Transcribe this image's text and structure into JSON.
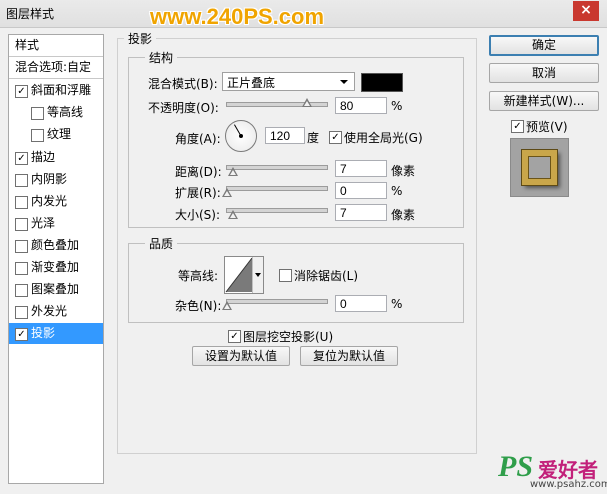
{
  "window": {
    "title": "图层样式",
    "watermark": "www.240PS.com",
    "close": "×"
  },
  "sidebar": {
    "styles_header": "样式",
    "blend_options": "混合选项:自定",
    "items": [
      {
        "label": "斜面和浮雕",
        "checked": true
      },
      {
        "label": "等高线",
        "checked": false
      },
      {
        "label": "纹理",
        "checked": false
      },
      {
        "label": "描边",
        "checked": true
      },
      {
        "label": "内阴影",
        "checked": false
      },
      {
        "label": "内发光",
        "checked": false
      },
      {
        "label": "光泽",
        "checked": false
      },
      {
        "label": "颜色叠加",
        "checked": false
      },
      {
        "label": "渐变叠加",
        "checked": false
      },
      {
        "label": "图案叠加",
        "checked": false
      },
      {
        "label": "外发光",
        "checked": false
      },
      {
        "label": "投影",
        "checked": true,
        "selected": true
      }
    ]
  },
  "panel": {
    "title": "投影",
    "structure": {
      "title": "结构",
      "blend_mode_label": "混合模式(B):",
      "blend_mode_value": "正片叠底",
      "blend_color": "#000000",
      "opacity_label": "不透明度(O):",
      "opacity_value": "80",
      "opacity_level": 80,
      "opacity_unit": "%",
      "angle_label": "角度(A):",
      "angle_value": "120",
      "angle_unit": "度",
      "global_light_label": "使用全局光(G)",
      "global_light_checked": true,
      "distance_label": "距离(D):",
      "distance_value": "7",
      "distance_unit": "像素",
      "spread_label": "扩展(R):",
      "spread_value": "0",
      "spread_unit": "%",
      "size_label": "大小(S):",
      "size_value": "7",
      "size_unit": "像素"
    },
    "quality": {
      "title": "品质",
      "contour_label": "等高线:",
      "antialias_label": "消除锯齿(L)",
      "antialias_checked": false,
      "noise_label": "杂色(N):",
      "noise_value": "0",
      "noise_unit": "%"
    },
    "knockout_label": "图层挖空投影(U)",
    "knockout_checked": true,
    "set_default": "设置为默认值",
    "reset_default": "复位为默认值"
  },
  "buttons": {
    "ok": "确定",
    "cancel": "取消",
    "new_style": "新建样式(W)...",
    "preview_label": "预览(V)",
    "preview_checked": true
  },
  "footer_watermark": {
    "ps": "PS",
    "cn": "爱好者",
    "url": "www.psahz.com"
  }
}
